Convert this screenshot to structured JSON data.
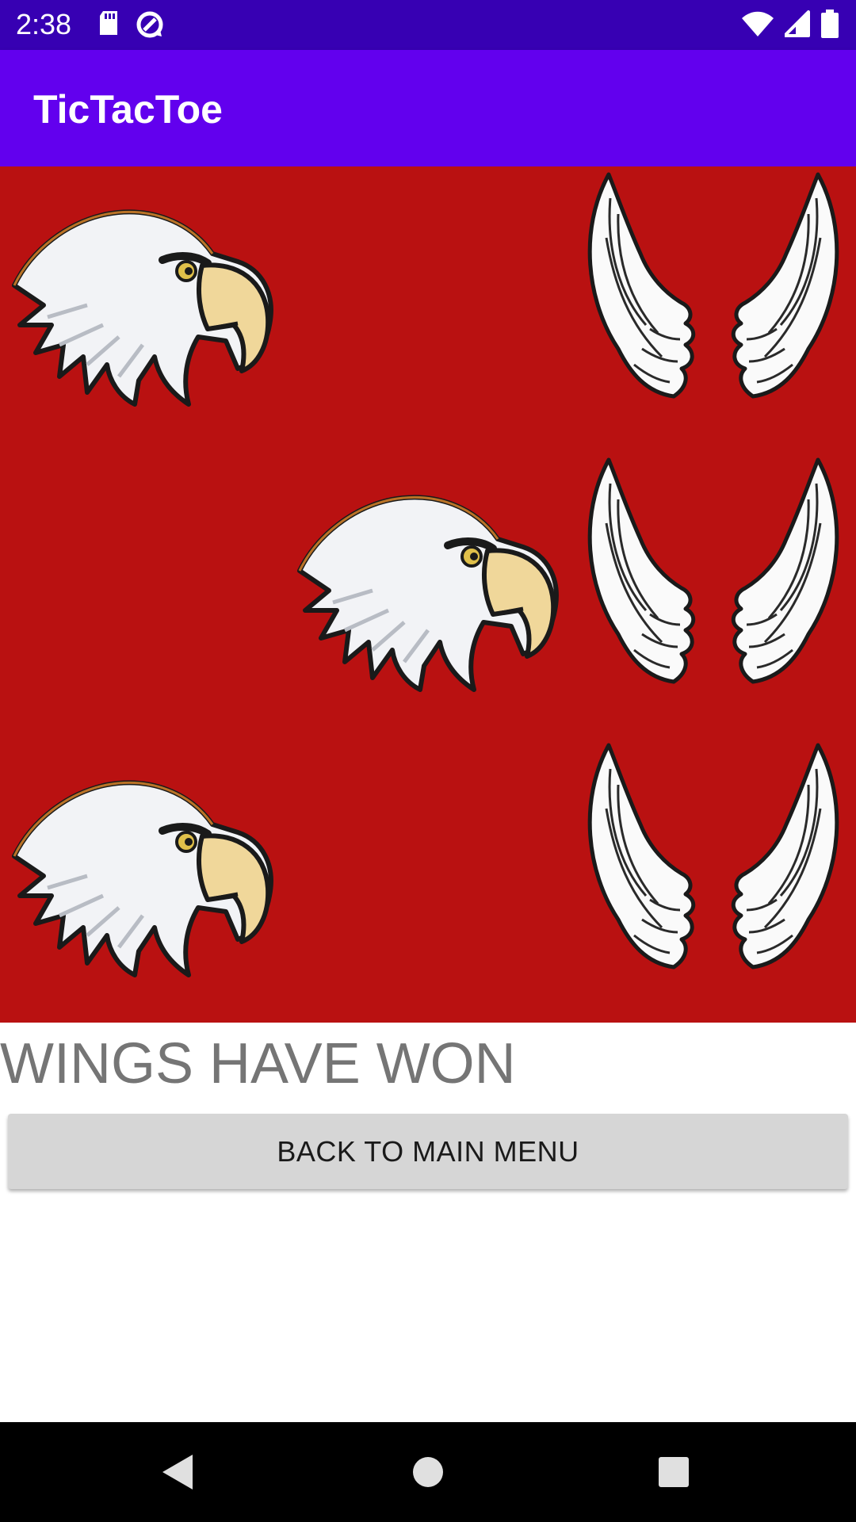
{
  "status_bar": {
    "time": "2:38",
    "left_icons": [
      "sd-card-icon",
      "data-saver-icon"
    ],
    "right_icons": [
      "wifi-icon",
      "signal-icon",
      "battery-icon"
    ]
  },
  "app_bar": {
    "title": "TicTacToe"
  },
  "board": {
    "background_color": "#b91111",
    "cells": [
      [
        "eagle",
        "empty",
        "wings"
      ],
      [
        "empty",
        "eagle",
        "wings"
      ],
      [
        "eagle",
        "empty",
        "wings"
      ]
    ]
  },
  "result": {
    "text": "WINGS HAVE WON"
  },
  "actions": {
    "main_menu_label": "BACK TO MAIN MENU"
  },
  "nav_bar": {
    "icons": [
      "back-icon",
      "home-icon",
      "recents-icon"
    ]
  },
  "colors": {
    "status_bar": "#3700b3",
    "app_bar": "#6200ee",
    "button": "#d6d6d6",
    "result_text": "#757575"
  }
}
